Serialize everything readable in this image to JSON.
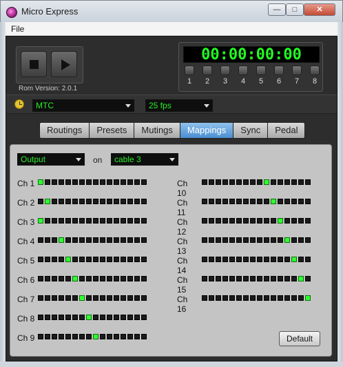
{
  "window": {
    "title": "Micro Express",
    "minimize": "—",
    "maximize": "□",
    "close": "✕"
  },
  "menu": {
    "file": "File"
  },
  "transport": {
    "rom_version": "Rom Version: 2.0.1"
  },
  "timecode": {
    "value": "00:00:00:00",
    "buttons": [
      "1",
      "2",
      "3",
      "4",
      "5",
      "6",
      "7",
      "8"
    ]
  },
  "sync": {
    "source": "MTC",
    "frame_rate": "25 fps"
  },
  "tabs": [
    {
      "label": "Routings",
      "active": false
    },
    {
      "label": "Presets",
      "active": false
    },
    {
      "label": "Mutings",
      "active": false
    },
    {
      "label": "Mappings",
      "active": true
    },
    {
      "label": "Sync",
      "active": false
    },
    {
      "label": "Pedal",
      "active": false
    }
  ],
  "mappings": {
    "direction": "Output",
    "on_label": "on",
    "cable": "cable 3",
    "default_label": "Default",
    "channels": [
      {
        "label": "Ch 1",
        "selected": 1
      },
      {
        "label": "Ch 2",
        "selected": 2
      },
      {
        "label": "Ch 3",
        "selected": 1
      },
      {
        "label": "Ch 4",
        "selected": 4
      },
      {
        "label": "Ch 5",
        "selected": 5
      },
      {
        "label": "Ch 6",
        "selected": 6
      },
      {
        "label": "Ch 7",
        "selected": 7
      },
      {
        "label": "Ch 8",
        "selected": 8
      },
      {
        "label": "Ch 9",
        "selected": 9
      },
      {
        "label": "Ch 10",
        "selected": 10
      },
      {
        "label": "Ch 11",
        "selected": 11
      },
      {
        "label": "Ch 12",
        "selected": 12
      },
      {
        "label": "Ch 13",
        "selected": 13
      },
      {
        "label": "Ch 14",
        "selected": 14
      },
      {
        "label": "Ch 15",
        "selected": 15
      },
      {
        "label": "Ch 16",
        "selected": 16
      }
    ]
  },
  "colors": {
    "led_on": "#31ff31",
    "led_off": "#1b1b1b",
    "accent_tab": "#4a8fd1",
    "timecode": "#22ff22"
  }
}
